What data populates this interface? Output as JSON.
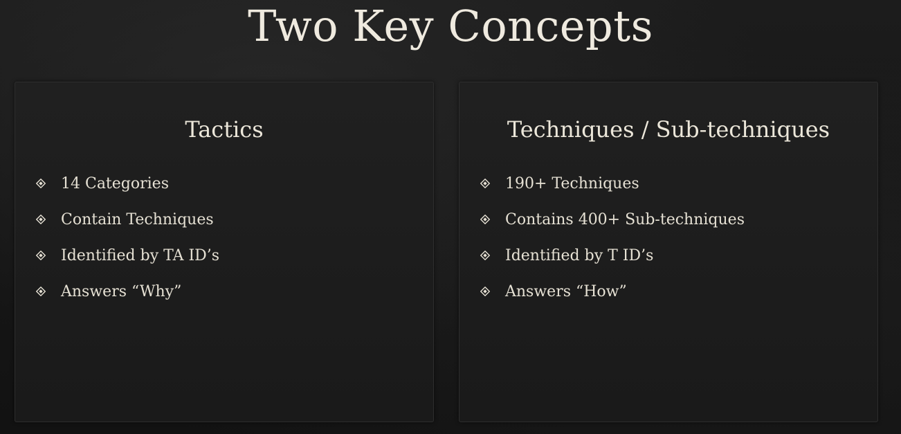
{
  "slide": {
    "title": "Two Key Concepts"
  },
  "left_panel": {
    "heading": "Tactics",
    "bullets": [
      "14 Categories",
      "Contain Techniques",
      "Identified by TA ID’s",
      "Answers “Why”"
    ]
  },
  "right_panel": {
    "heading": "Techniques / Sub-techniques",
    "bullets": [
      "190+ Techniques",
      "Contains 400+ Sub-techniques",
      "Identified by T ID’s",
      "Answers “How”"
    ]
  },
  "icons": {
    "bullet": "diamond-bullet-icon"
  },
  "colors": {
    "background": "#151515",
    "text": "#ece7da",
    "panel": "#1e1e1e"
  }
}
